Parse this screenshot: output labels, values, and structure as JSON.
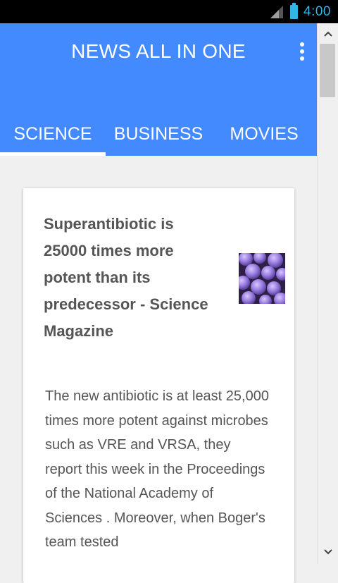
{
  "status_bar": {
    "time": "4:00",
    "icons": [
      "signal-icon",
      "battery-icon"
    ],
    "clock_color": "#33b5e5"
  },
  "header": {
    "title": "NEWS ALL IN ONE",
    "menu_icon": "overflow-menu-icon",
    "background_color": "#448aff"
  },
  "tabs": [
    {
      "label": "SCIENCE",
      "active": true
    },
    {
      "label": "BUSINESS",
      "active": false
    },
    {
      "label": "MOVIES",
      "active": false
    }
  ],
  "article": {
    "headline": "Superantibiotic is 25000 times more potent than its predecessor - Science Magazine",
    "thumbnail_icon": "bacteria-thumbnail",
    "summary": "The new antibiotic is at least 25,000 times more potent against microbes such as VRE and VRSA, they report this week in the Proceedings of the National Academy of Sciences . Moreover, when Boger's team tested"
  },
  "scrollbar": {
    "up_icon": "chevron-up-icon",
    "down_icon": "chevron-down-icon"
  }
}
